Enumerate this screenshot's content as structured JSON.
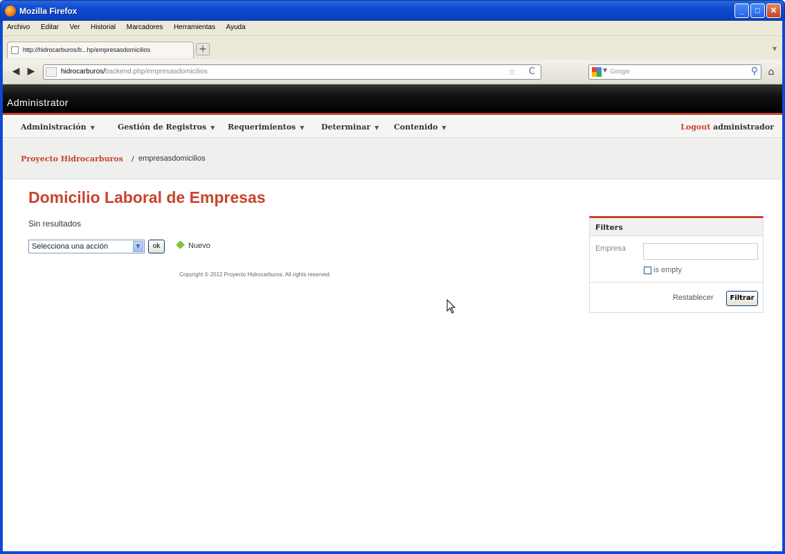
{
  "window": {
    "title": "Mozilla Firefox",
    "minimize_glyph": "_",
    "maximize_glyph": "□",
    "close_glyph": "✕"
  },
  "menubar": {
    "items": [
      "Archivo",
      "Editar",
      "Ver",
      "Historial",
      "Marcadores",
      "Herramientas",
      "Ayuda"
    ]
  },
  "tabs": {
    "active_label": "http://hidrocarburos/b...hp/empresasdomicilios",
    "new_tab_glyph": "+"
  },
  "navbar": {
    "back_glyph": "◀",
    "forward_glyph": "▶",
    "url_host": "hidrocarburos/",
    "url_path": "backend.php/empresasdomicilios",
    "star_glyph": "☆",
    "reload_glyph": "C",
    "search_placeholder": "Google",
    "search_glyph": "⚲",
    "home_glyph": "⌂"
  },
  "admin": {
    "title": "Administrator"
  },
  "nav": {
    "items": [
      "Administración",
      "Gestión de Registros",
      "Requerimientos",
      "Determinar",
      "Contenido"
    ],
    "caret": "▼",
    "logout_label": "Logout",
    "user": "administrador"
  },
  "breadcrumb": {
    "root": "Proyecto Hidrocarburos",
    "separator": "/",
    "current": "empresasdomicilios"
  },
  "main": {
    "title": "Domicilio Laboral de Empresas",
    "no_results": "Sin resultados",
    "action_select_value": "Selecciona una acción",
    "ok_label": "ok",
    "new_label": "Nuevo",
    "copyright": "Copyright © 2012 Proyecto Hidrocarburos. All rights reserved."
  },
  "filters": {
    "title": "Filters",
    "empresa_label": "Empresa",
    "empresa_value": "",
    "is_empty_label": "is empty",
    "reset_label": "Restablecer",
    "submit_label": "Filtrar"
  },
  "colors": {
    "accent": "#c8432c",
    "titlebar_blue": "#0d4ad1",
    "new_icon_green": "#7cc243"
  }
}
